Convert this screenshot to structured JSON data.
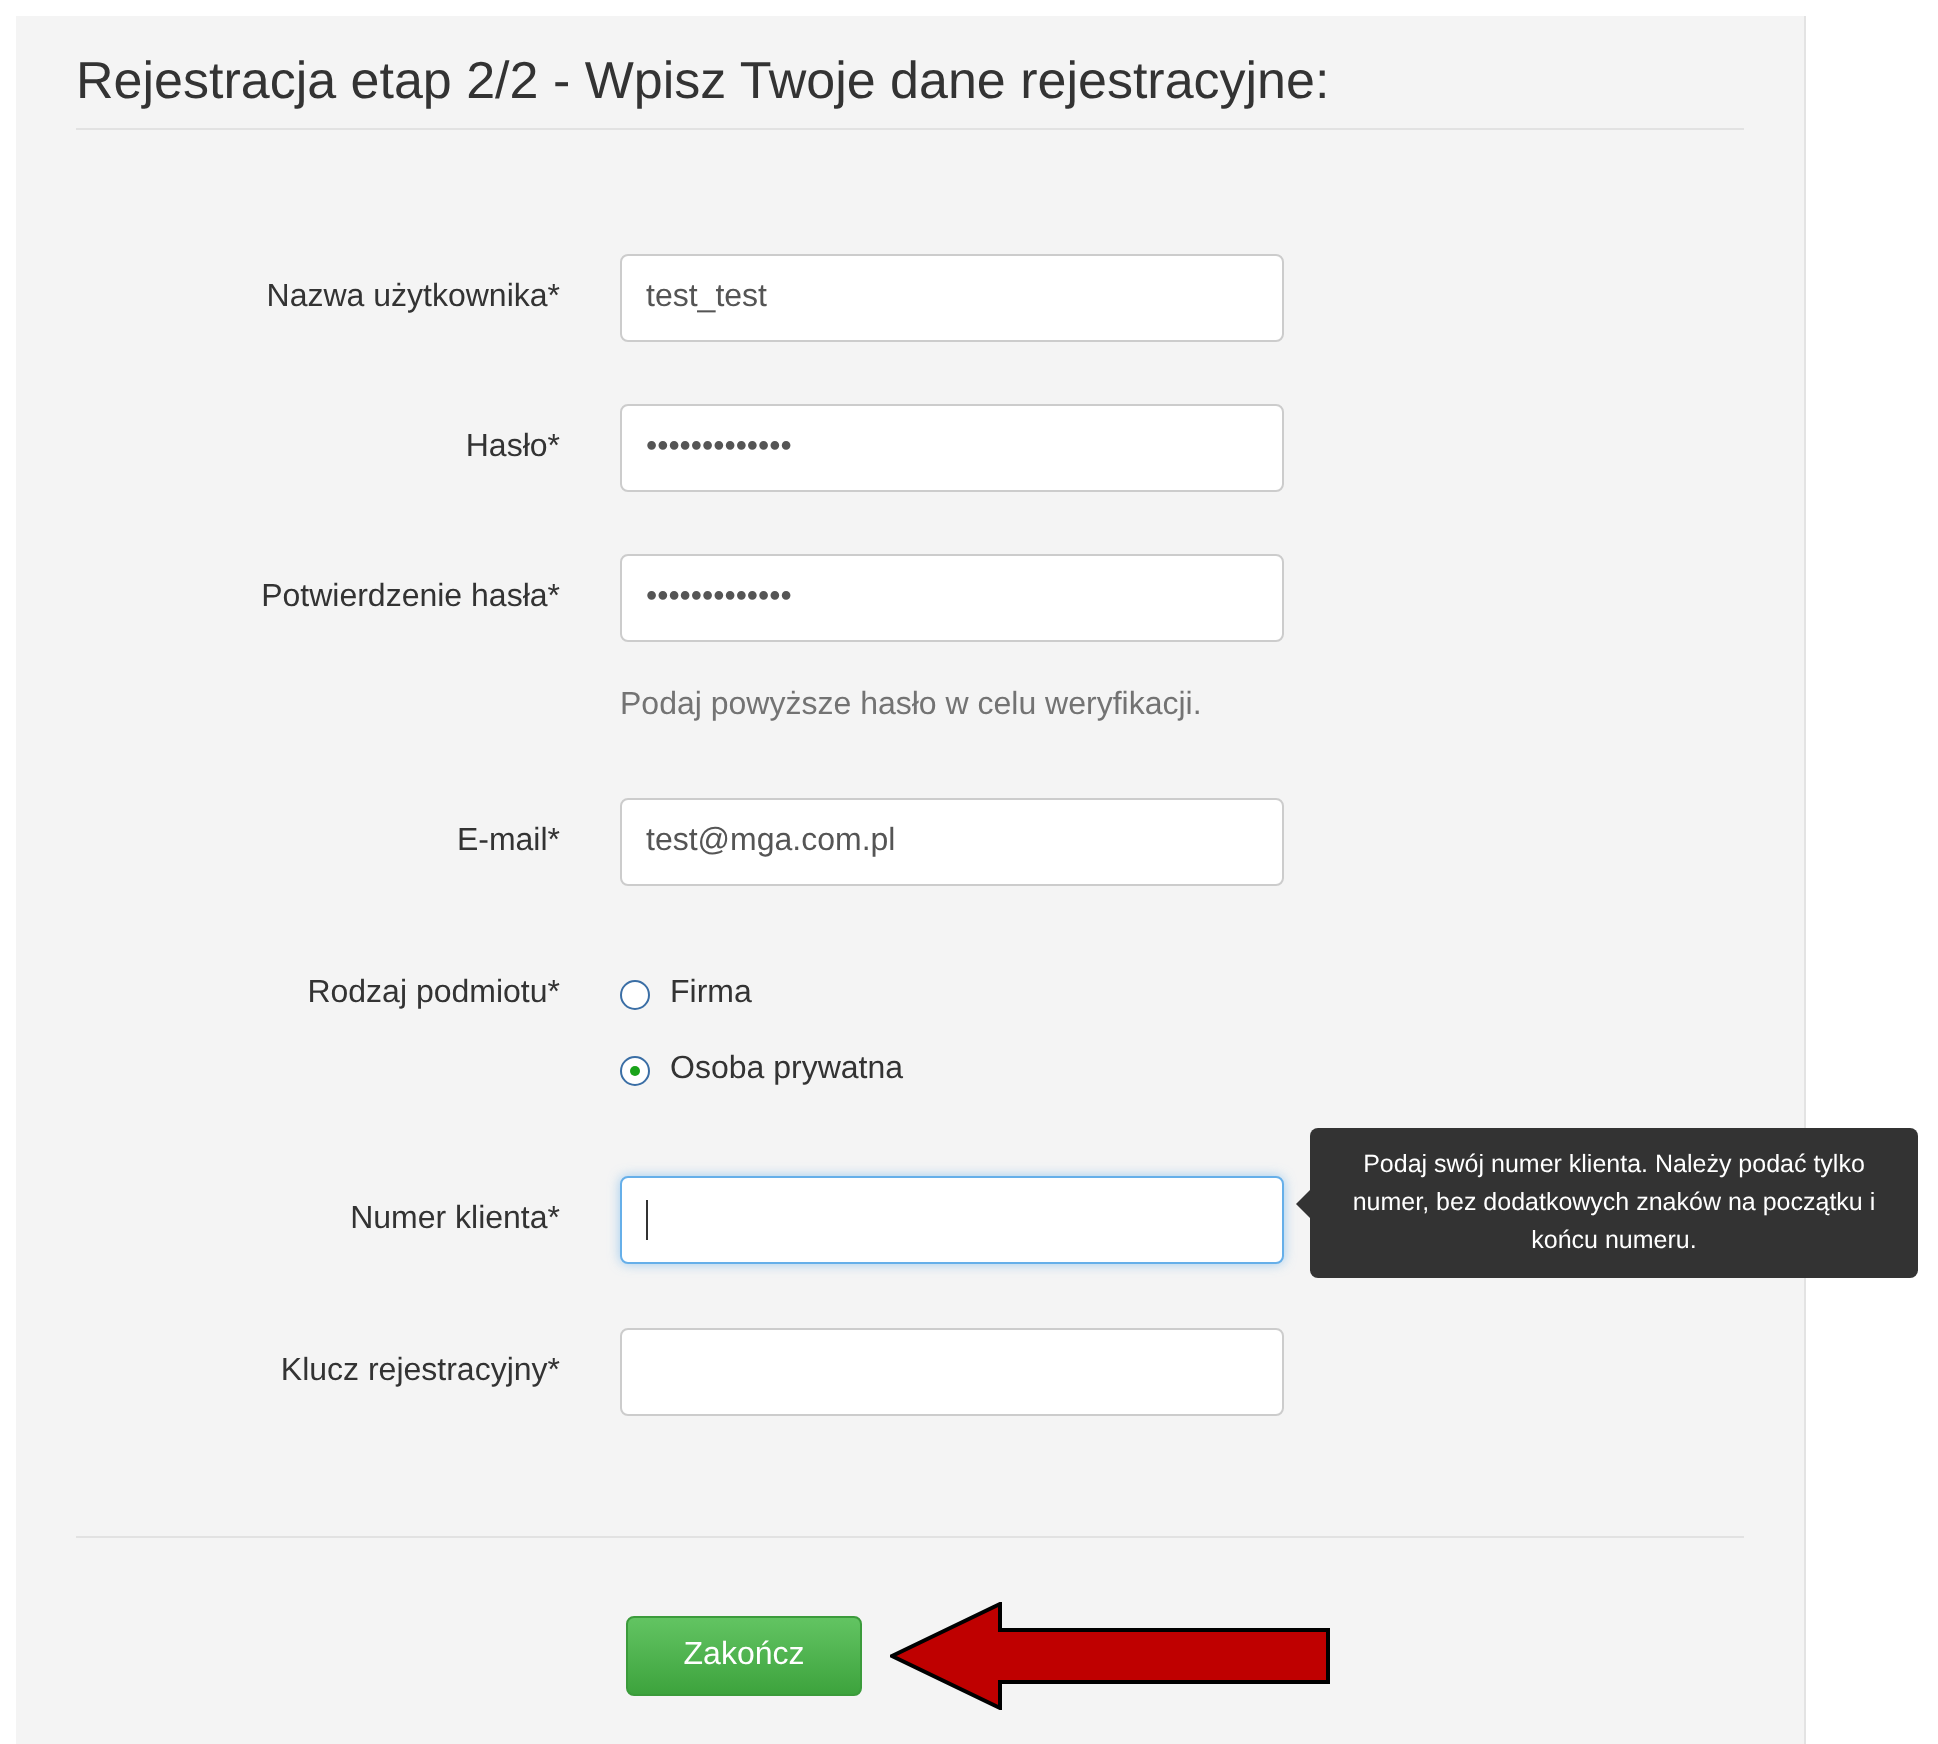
{
  "title": "Rejestracja etap 2/2 - Wpisz Twoje dane rejestracyjne:",
  "fields": [
    {
      "kind": "text",
      "label": "Nazwa użytkownika*",
      "value": "test_test",
      "focused": false
    },
    {
      "kind": "text",
      "label": "Hasło*",
      "value": "•••••••••••••",
      "focused": false
    },
    {
      "kind": "text",
      "label": "Potwierdzenie hasła*",
      "value": "•••••••••••••",
      "focused": false,
      "help": "Podaj powyższe hasło w celu weryfikacji."
    },
    {
      "kind": "text",
      "label": "E-mail*",
      "value": "test@mga.com.pl",
      "focused": false
    },
    {
      "kind": "radio",
      "label": "Rodzaj podmiotu*",
      "options": [
        {
          "label": "Firma",
          "selected": false
        },
        {
          "label": "Osoba prywatna",
          "selected": true
        }
      ]
    },
    {
      "kind": "text",
      "label": "Numer klienta*",
      "focused": true,
      "tooltip": "Podaj swój numer klienta. Należy podać tylko numer, bez dodatkowych znaków na początku i końcu numeru."
    },
    {
      "kind": "text",
      "label": "Klucz rejestracyjny*",
      "focused": false
    }
  ],
  "submit": "Zakończ"
}
